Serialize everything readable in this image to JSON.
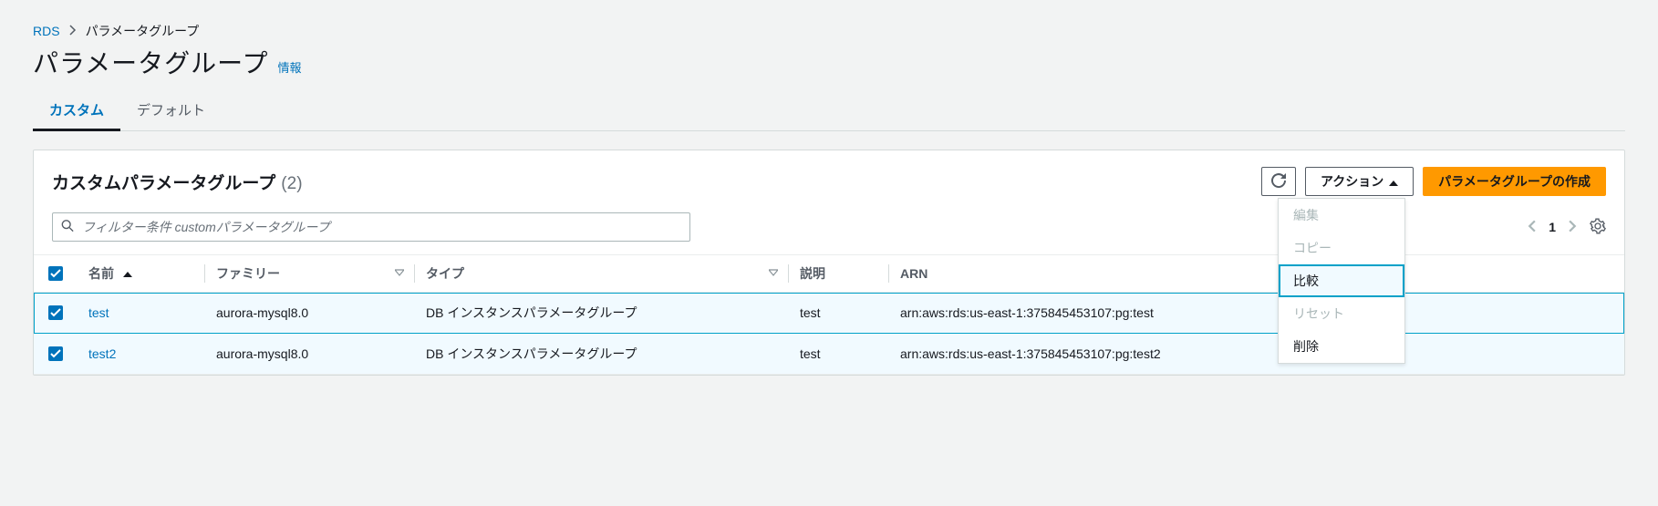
{
  "breadcrumb": {
    "root": "RDS",
    "current": "パラメータグループ"
  },
  "page": {
    "title": "パラメータグループ",
    "info": "情報"
  },
  "tabs": {
    "custom": "カスタム",
    "default": "デフォルト"
  },
  "panel": {
    "title": "カスタムパラメータグループ",
    "count": "(2)",
    "refresh_label": "更新",
    "actions_label": "アクション",
    "create_label": "パラメータグループの作成",
    "search_placeholder": "フィルター条件 customパラメータグループ",
    "page_num": "1"
  },
  "actions_menu": {
    "edit": "編集",
    "copy": "コピー",
    "compare": "比較",
    "reset": "リセット",
    "delete": "削除"
  },
  "columns": {
    "name": "名前",
    "family": "ファミリー",
    "type": "タイプ",
    "desc": "説明",
    "arn": "ARN"
  },
  "rows": [
    {
      "name": "test",
      "family": "aurora-mysql8.0",
      "type": "DB インスタンスパラメータグループ",
      "desc": "test",
      "arn": "arn:aws:rds:us-east-1:375845453107:pg:test"
    },
    {
      "name": "test2",
      "family": "aurora-mysql8.0",
      "type": "DB インスタンスパラメータグループ",
      "desc": "test",
      "arn": "arn:aws:rds:us-east-1:375845453107:pg:test2"
    }
  ]
}
